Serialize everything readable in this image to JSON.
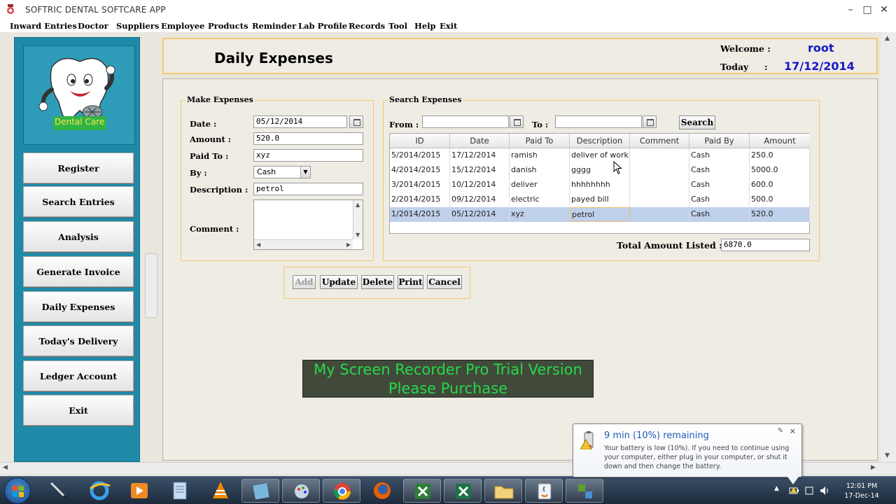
{
  "window": {
    "title": "SOFTRIC DENTAL SOFTCARE APP"
  },
  "menu": [
    "Inward Entries",
    "Doctor",
    "Suppliers",
    "Employee",
    "Products",
    "Reminder",
    "Lab Profile",
    "Records",
    "Tool",
    "Help",
    "Exit"
  ],
  "sidebar": {
    "logo_text": "Dental Care",
    "buttons": [
      "Register",
      "Search Entries",
      "Analysis",
      "Generate Invoice",
      "Daily Expenses",
      "Today's Delivery",
      "Ledger Account",
      "Exit"
    ]
  },
  "header": {
    "title": "Daily Expenses",
    "welcome_label": "Welcome :",
    "user": "root",
    "today_label": "Today",
    "today_colon": ":",
    "date": "17/12/2014"
  },
  "make_expenses": {
    "legend": "Make Expenses",
    "date_label": "Date :",
    "date_value": "05/12/2014",
    "amount_label": "Amount :",
    "amount_value": "520.0",
    "paid_to_label": "Paid To :",
    "paid_to_value": "xyz",
    "by_label": "By :",
    "by_value": "Cash",
    "description_label": "Description :",
    "description_value": "petrol",
    "comment_label": "Comment :"
  },
  "actions": {
    "add": "Add",
    "update": "Update",
    "delete": "Delete",
    "print": "Print",
    "cancel": "Cancel"
  },
  "search_expenses": {
    "legend": "Search Expenses",
    "from_label": "From :",
    "to_label": "To :",
    "search_button": "Search",
    "columns": [
      "ID",
      "Date",
      "Paid To",
      "Description",
      "Comment",
      "Paid By",
      "Amount"
    ],
    "rows": [
      [
        "5/2014/2015",
        "17/12/2014",
        "ramish",
        "deliver of work",
        "",
        "Cash",
        "250.0"
      ],
      [
        "4/2014/2015",
        "15/12/2014",
        "danish",
        "gggg",
        "",
        "Cash",
        "5000.0"
      ],
      [
        "3/2014/2015",
        "10/12/2014",
        "deliver",
        "hhhhhhhh",
        "",
        "Cash",
        "600.0"
      ],
      [
        "2/2014/2015",
        "09/12/2014",
        "electric",
        "payed bill",
        "",
        "Cash",
        "500.0"
      ],
      [
        "1/2014/2015",
        "05/12/2014",
        "xyz",
        "petrol",
        "",
        "Cash",
        "520.0"
      ]
    ],
    "total_label": "Total Amount Listed :",
    "total_value": "6870.0"
  },
  "watermark": {
    "line1": "My Screen Recorder Pro Trial Version",
    "line2": "Please Purchase"
  },
  "notification": {
    "title": "9 min (10%) remaining",
    "message": "Your battery is low (10%). If you need to continue using your computer, either plug in your computer, or shut it down and then change the battery."
  },
  "taskbar": {
    "apps": [
      "start-icon",
      "pen-icon",
      "internet-explorer-icon",
      "media-player-icon",
      "notepad-icon",
      "vlc-icon",
      "notebook-icon",
      "paint-icon",
      "chrome-icon",
      "firefox-icon",
      "spreadsheet-icon",
      "excel-icon",
      "folder-icon",
      "java-icon",
      "network-icon"
    ],
    "time": "12:01 PM",
    "date": "17-Dec-14"
  }
}
